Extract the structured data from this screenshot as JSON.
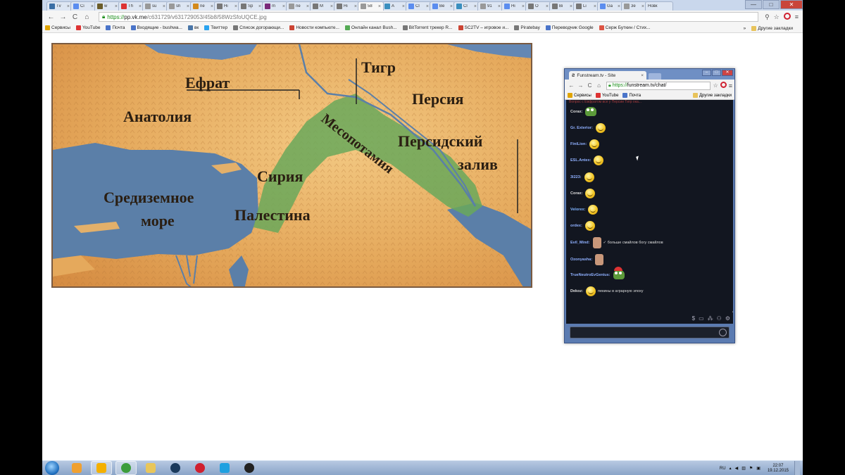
{
  "tabs": [
    {
      "icon": "tw",
      "title": "Tv",
      "color": "#3a6ea5"
    },
    {
      "icon": "G",
      "title": "Ci",
      "color": "#5b8def"
    },
    {
      "icon": "w",
      "title": "w",
      "color": "#6b5d2a"
    },
    {
      "icon": "yt",
      "title": "Th",
      "color": "#d33"
    },
    {
      "icon": "doc",
      "title": "su",
      "color": "#999"
    },
    {
      "icon": "doc",
      "title": "sh",
      "color": "#999"
    },
    {
      "icon": "G",
      "title": "ne",
      "color": "#d38a1c"
    },
    {
      "icon": "W",
      "title": "Hi",
      "color": "#777"
    },
    {
      "icon": "W",
      "title": "Sp",
      "color": "#777"
    },
    {
      "icon": "m",
      "title": "m",
      "color": "#7a2a7a"
    },
    {
      "icon": "doc",
      "title": "ne",
      "color": "#999"
    },
    {
      "icon": "W",
      "title": "M",
      "color": "#777"
    },
    {
      "icon": "W",
      "title": "Hi",
      "color": "#777"
    },
    {
      "icon": "doc",
      "title": "58",
      "color": "#999",
      "active": true
    },
    {
      "icon": "A",
      "title": "A",
      "color": "#3a8fbf"
    },
    {
      "icon": "G",
      "title": "Cl",
      "color": "#5b8def"
    },
    {
      "icon": "G",
      "title": "Be",
      "color": "#5b8def"
    },
    {
      "icon": "A",
      "title": "Cl",
      "color": "#3a8fbf"
    },
    {
      "icon": "doc",
      "title": "91",
      "color": "#999"
    },
    {
      "icon": "G",
      "title": "Hi",
      "color": "#5b8def"
    },
    {
      "icon": "W",
      "title": "O",
      "color": "#777"
    },
    {
      "icon": "W",
      "title": "Bi",
      "color": "#777"
    },
    {
      "icon": "W",
      "title": "Li",
      "color": "#777"
    },
    {
      "icon": "G",
      "title": "Ga",
      "color": "#5b8def"
    },
    {
      "icon": "doc",
      "title": "3e",
      "color": "#999"
    }
  ],
  "tab_close": "×",
  "last_tab": "Новк",
  "window_controls": {
    "minimize": "—",
    "maximize": "□",
    "close": "✕"
  },
  "toolbar": {
    "back": "←",
    "forward": "→",
    "reload": "C",
    "home": "⌂",
    "url_scheme": "https://",
    "url_host": "pp.vk.me",
    "url_path": "/c631729/v631729053/45b8/58WzSfoUQCE.jpg",
    "zoom_icon": "⚲",
    "star_icon": "☆",
    "menu_icon": "≡"
  },
  "bookmarks": [
    {
      "label": "Сервисы",
      "color": "#e0a400"
    },
    {
      "label": "YouTube",
      "color": "#d33"
    },
    {
      "label": "Почта",
      "color": "#4a74c9"
    },
    {
      "label": "Входящие - bushwa...",
      "color": "#4a74c9"
    },
    {
      "label": "вк",
      "color": "#4a76a8"
    },
    {
      "label": "Твиттер",
      "color": "#2aa3ef"
    },
    {
      "label": "Список догорающи...",
      "color": "#777"
    },
    {
      "label": "Новости компьюте...",
      "color": "#c43"
    },
    {
      "label": "Онлайн канал Bush...",
      "color": "#5a5"
    },
    {
      "label": "BitTorrent трекер R...",
      "color": "#777"
    },
    {
      "label": "SC2TV – игровое и...",
      "color": "#c43"
    },
    {
      "label": "Piratebay",
      "color": "#777"
    },
    {
      "label": "Переводчик Google",
      "color": "#4a74c9"
    },
    {
      "label": "Серж Буткин / Стих...",
      "color": "#d54"
    }
  ],
  "bookmarks_more": "»",
  "bookmarks_other": "Другие закладки",
  "map": {
    "labels": {
      "euphrates": "Ефрат",
      "tigris": "Тигр",
      "persia": "Персия",
      "anatolia": "Анатолия",
      "mesopotamia": "Месопотамия",
      "persian_gulf_1": "Персидский",
      "persian_gulf_2": "залив",
      "syria": "Сирия",
      "med_1": "Средиземное",
      "med_2": "море",
      "palestine": "Палестина"
    },
    "colors": {
      "sea": "#5b7fa8",
      "land": "#e8b468",
      "fertile": "#6aa85a",
      "highland": "#c98a4a"
    }
  },
  "popup": {
    "tab_title": "Funstream.tv - Site",
    "tab_close": "×",
    "controls": {
      "minimize": "–",
      "maximize": "□",
      "close": "✕"
    },
    "url_scheme": "https://",
    "url_rest": "funstream.tv/chat/",
    "bookmarks": [
      {
        "label": "Сервисы",
        "color": "#e0a400"
      },
      {
        "label": "YouTube",
        "color": "#d33"
      },
      {
        "label": "Почта",
        "color": "#4a74c9"
      }
    ],
    "bookmarks_other": "Другие закладки",
    "top_cut_text": "Вопрос с Евфратом все у Персии Тигр ока...",
    "messages": [
      {
        "nick": "Corax:",
        "color": "#dddddd",
        "emote": "frog",
        "text": ""
      },
      {
        "nick": "Gr. Exterior:",
        "color": "#8fb0ff",
        "emote": "smile",
        "text": ""
      },
      {
        "nick": "FiniLion:",
        "color": "#8fb0ff",
        "emote": "smile",
        "text": ""
      },
      {
        "nick": "ESL.Antex:",
        "color": "#8fb0ff",
        "emote": "smile",
        "text": ""
      },
      {
        "nick": "3l223:",
        "color": "#8fb0ff",
        "emote": "smile",
        "text": ""
      },
      {
        "nick": "Corax:",
        "color": "#dddddd",
        "emote": "smile",
        "text": ""
      },
      {
        "nick": "Velorex:",
        "color": "#7fb3ff",
        "emote": "smile",
        "text": ""
      },
      {
        "nick": "ordex:",
        "color": "#8fb0ff",
        "emote": "smile",
        "text": ""
      },
      {
        "nick": "Evil_Mind:",
        "color": "#8fb0ff",
        "emote": "face",
        "text": "✓ больше смайлов богу смайлов"
      },
      {
        "nick": "Ozonyasha:",
        "color": "#8fb0ff",
        "emote": "face",
        "text": ""
      },
      {
        "nick": "TrueNeutroEvGenius:",
        "color": "#8fb0ff",
        "emote": "frog-hat",
        "text": ""
      },
      {
        "nick": "Dekoz:",
        "color": "#dddddd",
        "emote": "smile",
        "text": "пекины в аграрную эпоху"
      }
    ],
    "icons": [
      "$",
      "▭",
      "⁂",
      "⚇",
      "⚙"
    ]
  },
  "taskbar": {
    "apps": [
      {
        "name": "media-player-icon",
        "color": "#f0a030",
        "running": false
      },
      {
        "name": "aimp-icon",
        "color": "#f4b000",
        "running": true
      },
      {
        "name": "chrome-icon",
        "color": "#3c9d3c",
        "running": true
      },
      {
        "name": "explorer-icon",
        "color": "#e9c65a",
        "running": false
      },
      {
        "name": "steam-icon",
        "color": "#1b3a5c",
        "running": false
      },
      {
        "name": "opera-icon",
        "color": "#d0202f",
        "running": false
      },
      {
        "name": "skype-icon",
        "color": "#1ea0e0",
        "running": false
      },
      {
        "name": "obs-icon",
        "color": "#222",
        "running": false
      }
    ],
    "lang": "RU",
    "time": "22:07",
    "date": "19.12.2015"
  }
}
